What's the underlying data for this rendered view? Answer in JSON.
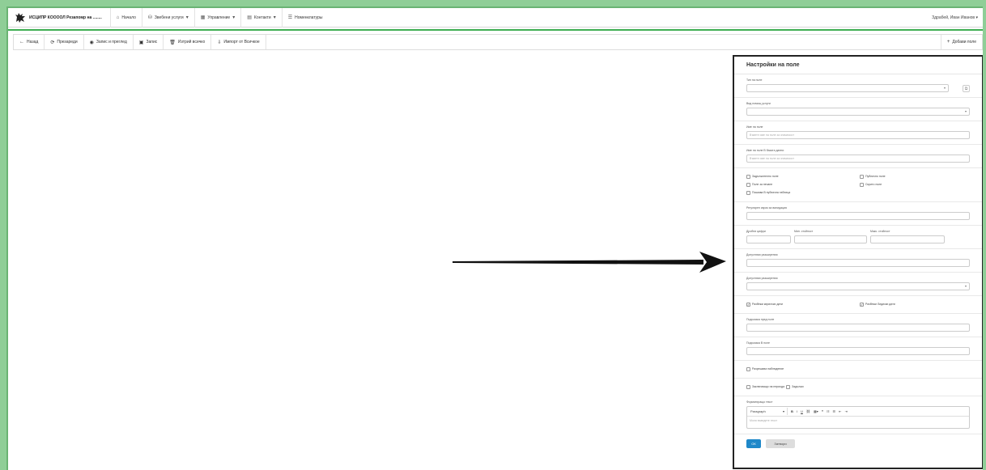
{
  "app": {
    "brand": "ИСЦИПР КООООЛ Резапомр на ........",
    "user": "Здрабей, Иван Иванов"
  },
  "nav": [
    {
      "label": "Начало",
      "icon": "home-icon",
      "glyph": "⌂",
      "caret": ""
    },
    {
      "label": "Звебени услуги",
      "icon": "database-icon",
      "glyph": "⛁",
      "caret": "▾"
    },
    {
      "label": "Управление",
      "icon": "grid-icon",
      "glyph": "▦",
      "caret": "▾"
    },
    {
      "label": "Контакти",
      "icon": "table-icon",
      "glyph": "▤",
      "caret": "▾"
    },
    {
      "label": "Номенклатуры",
      "icon": "list-icon",
      "glyph": "☰",
      "caret": ""
    }
  ],
  "toolbar": {
    "back": "Назад",
    "refresh": "Презареди",
    "save_preview": "Запис и преглед",
    "save": "Запис",
    "delete": "Изтрий всичко",
    "import": "Импорт от Всичкое",
    "add_field": "Добави поле"
  },
  "panel": {
    "title": "Настройки на поле",
    "field_type_label": "Тип на поле",
    "field_kind_label": "Вид помощ услуги",
    "field_name_label": "Име на поле",
    "field_name_ph": "Въвете име на поле за значимост",
    "db_name_label": "Име на поле В базата данни",
    "db_name_ph": "Въвете име на поле за значимост",
    "checks": [
      [
        "Задължително поле",
        "Публично поле"
      ],
      [
        "Поле за печане",
        "Скрито поле"
      ],
      [
        "Показва В публична таблица",
        ""
      ]
    ],
    "regex_label": "Регулярен израз за валидация",
    "decimals_label": "Дробни цифри",
    "min_label": "Мин. стойност",
    "max_label": "Макс. стойност",
    "ext_label": "Допустими разширения",
    "allowed_label": "Допустими разширения",
    "allow_cyr": "Разбежи кирилски дати",
    "allow_lat": "Разбежи Лидиски дати",
    "hint_before": "Подсказка пред поле",
    "hint_in": "Подсказка В поле",
    "readonly": "Разрешава наблюдение",
    "comment": "Заключващо на периода",
    "comment2": "Задължи",
    "rich_label": "Форматиращо текст",
    "paragraph": "Paragraph",
    "rich_ph": "Моля въведете текст",
    "ok": "ОК",
    "cancel": "Затвори"
  }
}
